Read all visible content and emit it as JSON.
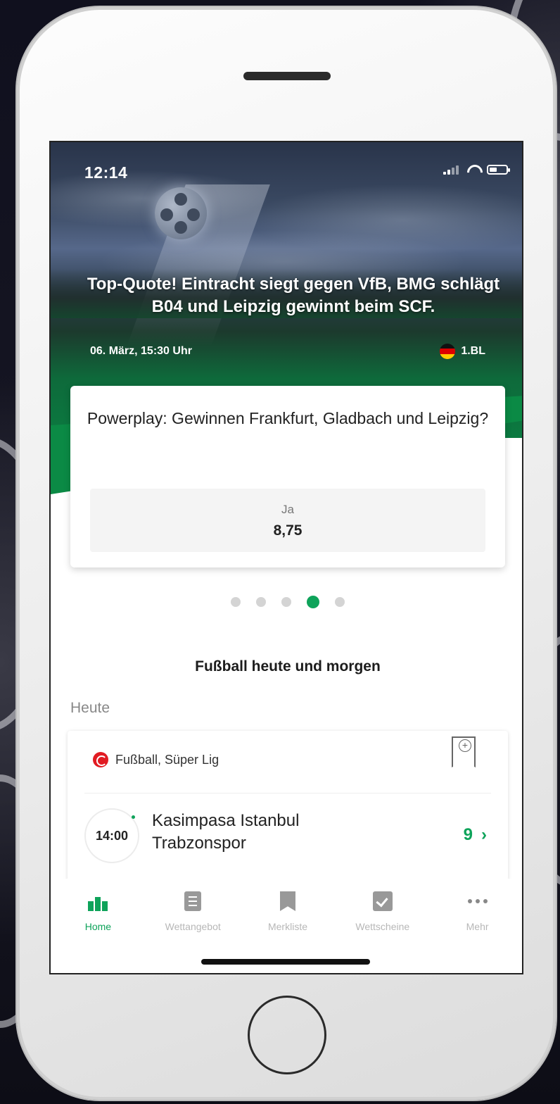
{
  "status_bar": {
    "time": "12:14"
  },
  "hero": {
    "headline": "Top-Quote! Eintracht siegt gegen VfB, BMG schlägt B04 und  Leipzig gewinnt beim SCF.",
    "date": "06. März, 15:30 Uhr",
    "league": "1.BL"
  },
  "bet_card": {
    "question": "Powerplay: Gewinnen Frankfurt, Gladbach und Leipzig?",
    "option_label": "Ja",
    "option_odds": "8,75"
  },
  "pager": {
    "count": 5,
    "active_index": 3
  },
  "section": {
    "title": "Fußball heute und morgen",
    "day": "Heute"
  },
  "match": {
    "league": "Fußball, Süper Lig",
    "time": "14:00",
    "home_team": "Kasimpasa Istanbul",
    "away_team": "Trabzonspor",
    "more_bets": "9",
    "chevron": "›"
  },
  "tabbar": {
    "items": [
      {
        "label": "Home",
        "icon": "home-bars-icon",
        "active": true
      },
      {
        "label": "Wettangebot",
        "icon": "list-icon",
        "active": false
      },
      {
        "label": "Merkliste",
        "icon": "bookmark-icon",
        "active": false
      },
      {
        "label": "Wettscheine",
        "icon": "checkbox-icon",
        "active": false
      },
      {
        "label": "Mehr",
        "icon": "more-icon",
        "active": false
      }
    ]
  },
  "colors": {
    "accent": "#0ea35a",
    "hero_green": "#0b8a45"
  }
}
